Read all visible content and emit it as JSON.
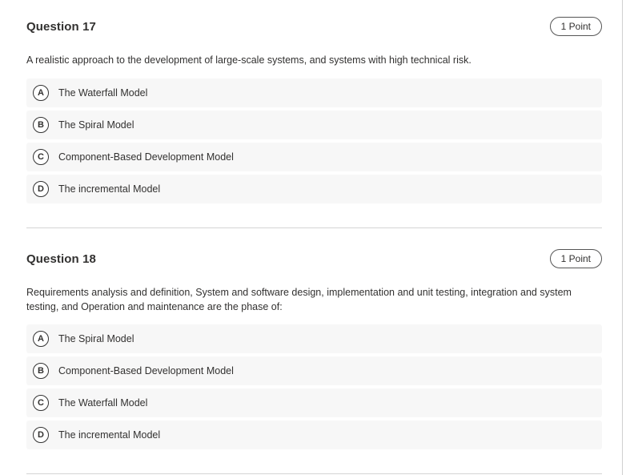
{
  "questions": [
    {
      "title": "Question 17",
      "points": "1 Point",
      "text": "A realistic approach to the development of large-scale systems, and systems with high technical risk.",
      "options": [
        {
          "letter": "A",
          "label": "The Waterfall Model"
        },
        {
          "letter": "B",
          "label": "The Spiral Model"
        },
        {
          "letter": "C",
          "label": "Component-Based Development Model"
        },
        {
          "letter": "D",
          "label": "The incremental Model"
        }
      ]
    },
    {
      "title": "Question 18",
      "points": "1 Point",
      "text": "Requirements analysis and definition, System and software design, implementation and unit testing, integration and system testing, and Operation and maintenance are the phase of:",
      "options": [
        {
          "letter": "A",
          "label": "The Spiral Model"
        },
        {
          "letter": "B",
          "label": "Component-Based Development Model"
        },
        {
          "letter": "C",
          "label": "The Waterfall Model"
        },
        {
          "letter": "D",
          "label": "The incremental Model"
        }
      ]
    }
  ],
  "colors": {
    "text": "#323130",
    "option_bg": "#f7f7f7",
    "divider": "#d4d4d4"
  }
}
